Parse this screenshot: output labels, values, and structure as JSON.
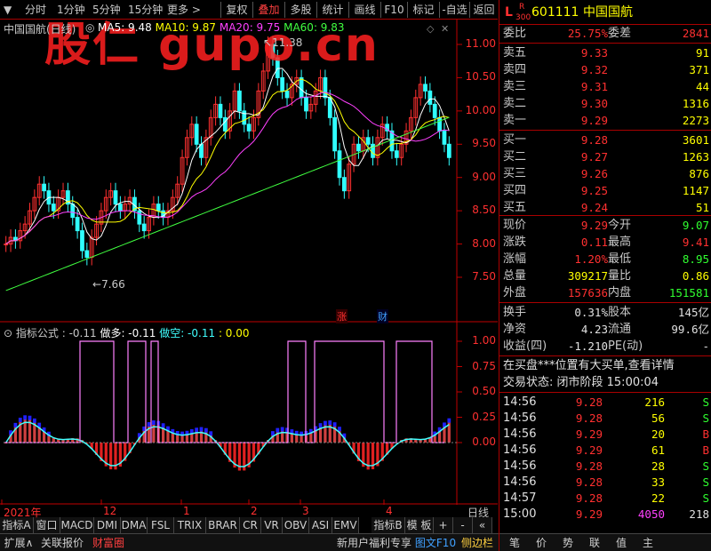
{
  "toolbar": {
    "left": [
      "分时",
      "1分钟",
      "5分钟",
      "15分钟",
      "更多 >"
    ],
    "buttons": [
      "复权",
      "叠加",
      "多股",
      "统计",
      "画线",
      "F10",
      "标记",
      "-自选",
      "返回"
    ],
    "active_button": "叠加"
  },
  "watermark": "股仁 gupo.cn",
  "main_chart": {
    "title": "中国国航(日线)",
    "ma": [
      {
        "label": "MA5: 9.48",
        "color": "#ffffff"
      },
      {
        "label": "MA10: 9.87",
        "color": "#ffff00"
      },
      {
        "label": "MA20: 9.75",
        "color": "#ff40ff"
      },
      {
        "label": "MA60: 9.83",
        "color": "#40ff40"
      }
    ],
    "price_ticks": [
      "11.00",
      "10.50",
      "10.00",
      "9.50",
      "9.00",
      "8.50",
      "8.00",
      "7.50"
    ],
    "high_marker": "11.38",
    "low_marker": "7.66",
    "tag_rise": "涨",
    "tag_fin": "财"
  },
  "sub_chart": {
    "title": "指标公式 : -0.11",
    "long_label": "做多: -0.11",
    "short_label": "做空: -0.11",
    "extra": ": 0.00",
    "ticks": [
      "1.00",
      "0.75",
      "0.50",
      "0.25",
      "0.00"
    ]
  },
  "time_axis": {
    "labels": [
      "2021年",
      "12",
      "1",
      "2",
      "3",
      "4"
    ],
    "end_label": "日线"
  },
  "tabs": [
    "指标A",
    "窗口",
    "MACD",
    "DMI",
    "DMA",
    "FSL",
    "TRIX",
    "BRAR",
    "CR",
    "VR",
    "OBV",
    "ASI",
    "EMV",
    "指标B",
    "模 板",
    "+",
    "-",
    "«"
  ],
  "bottom": {
    "left": [
      "扩展∧",
      "关联报价",
      "财富圈"
    ],
    "right": [
      "新用户福利专享",
      "图文F10",
      "侧边栏《"
    ],
    "icons": [
      "笔",
      "价",
      "势",
      "联",
      "值",
      "主"
    ]
  },
  "quote": {
    "l_label": "L",
    "r_label": "R",
    "sub_num": "300",
    "code": "601111",
    "name": "中国国航",
    "weibi_label": "委比",
    "weibi": "25.75%",
    "weicha_label": "委差",
    "weicha": "2841",
    "asks": [
      {
        "label": "卖五",
        "price": "9.33",
        "vol": "91"
      },
      {
        "label": "卖四",
        "price": "9.32",
        "vol": "371"
      },
      {
        "label": "卖三",
        "price": "9.31",
        "vol": "44"
      },
      {
        "label": "卖二",
        "price": "9.30",
        "vol": "1316"
      },
      {
        "label": "卖一",
        "price": "9.29",
        "vol": "2273"
      }
    ],
    "bids": [
      {
        "label": "买一",
        "price": "9.28",
        "vol": "3601"
      },
      {
        "label": "买二",
        "price": "9.27",
        "vol": "1263"
      },
      {
        "label": "买三",
        "price": "9.26",
        "vol": "876"
      },
      {
        "label": "买四",
        "price": "9.25",
        "vol": "1147"
      },
      {
        "label": "买五",
        "price": "9.24",
        "vol": "51"
      }
    ],
    "stats": [
      {
        "l1": "现价",
        "v1": "9.29",
        "c1": "red",
        "l2": "今开",
        "v2": "9.07",
        "c2": "grn"
      },
      {
        "l1": "涨跌",
        "v1": "0.11",
        "c1": "red",
        "l2": "最高",
        "v2": "9.41",
        "c2": "red"
      },
      {
        "l1": "涨幅",
        "v1": "1.20%",
        "c1": "red",
        "l2": "最低",
        "v2": "8.95",
        "c2": "grn"
      },
      {
        "l1": "总量",
        "v1": "309217",
        "c1": "yel",
        "l2": "量比",
        "v2": "0.86",
        "c2": "yel"
      },
      {
        "l1": "外盘",
        "v1": "157636",
        "c1": "red",
        "l2": "内盘",
        "v2": "151581",
        "c2": "grn"
      }
    ],
    "fin": [
      {
        "l1": "换手",
        "v1": "0.31%",
        "l2": "股本",
        "v2": "145亿"
      },
      {
        "l1": "净资",
        "v1": "4.23",
        "l2": "流通",
        "v2": "99.6亿"
      },
      {
        "l1": "收益(四)",
        "v1": "-1.210",
        "l2": "PE(动)",
        "v2": "-"
      }
    ],
    "notice": "在买盘***位置有大买单,查看详情",
    "status": "交易状态: 闭市阶段 15:00:04",
    "ticks": [
      {
        "t": "14:56",
        "p": "9.28",
        "v": "216",
        "d": "S"
      },
      {
        "t": "14:56",
        "p": "9.28",
        "v": "56",
        "d": "S"
      },
      {
        "t": "14:56",
        "p": "9.29",
        "v": "20",
        "d": "B"
      },
      {
        "t": "14:56",
        "p": "9.29",
        "v": "61",
        "d": "B"
      },
      {
        "t": "14:56",
        "p": "9.28",
        "v": "28",
        "d": "S"
      },
      {
        "t": "14:56",
        "p": "9.28",
        "v": "33",
        "d": "S"
      },
      {
        "t": "14:57",
        "p": "9.28",
        "v": "22",
        "d": "S"
      },
      {
        "t": "15:00",
        "p": "9.29",
        "v": "4050",
        "d": "218"
      }
    ]
  },
  "colors": {
    "up": "#ff3030",
    "down": "#30ff30",
    "grid": "#a00000",
    "axis": "#c00000"
  }
}
